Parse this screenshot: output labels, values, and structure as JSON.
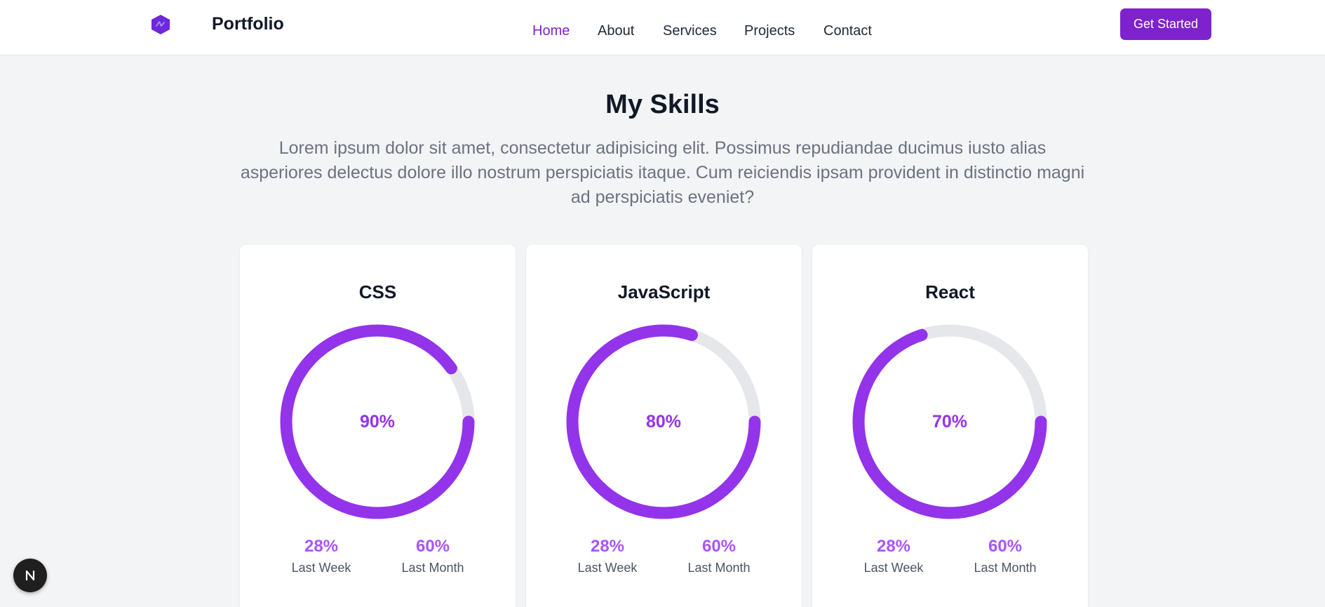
{
  "nav": {
    "logo_text": "Portfolio",
    "logo_icon": "hexagon-logo-icon",
    "links": [
      "Home",
      "About",
      "Services",
      "Projects",
      "Contact"
    ],
    "active_link": "Home",
    "cta_label": "Get Started"
  },
  "skills": {
    "title": "My Skills",
    "description": "Lorem ipsum dolor sit amet, consectetur adipisicing elit. Possimus repudiandae ducimus iusto alias asperiores delectus dolore illo nostrum perspiciatis itaque. Cum reiciendis ipsam provident in distinctio magni ad perspiciatis eveniet?",
    "cards": [
      {
        "name": "CSS",
        "percent_label": "90%",
        "progress": 0.9,
        "last_week_value": "28%",
        "last_week_label": "Last Week",
        "last_month_value": "60%",
        "last_month_label": "Last Month"
      },
      {
        "name": "JavaScript",
        "percent_label": "80%",
        "progress": 0.8,
        "last_week_value": "28%",
        "last_week_label": "Last Week",
        "last_month_value": "60%",
        "last_month_label": "Last Month"
      },
      {
        "name": "React",
        "percent_label": "70%",
        "progress": 0.7,
        "last_week_value": "28%",
        "last_week_label": "Last Week",
        "last_month_value": "60%",
        "last_month_label": "Last Month"
      }
    ]
  },
  "colors": {
    "accent": "#9333ea",
    "button": "#7e22ce",
    "ring_track": "#e5e7eb",
    "background": "#f3f4f6"
  },
  "dev_badge": {
    "icon": "nextjs-n-icon"
  }
}
